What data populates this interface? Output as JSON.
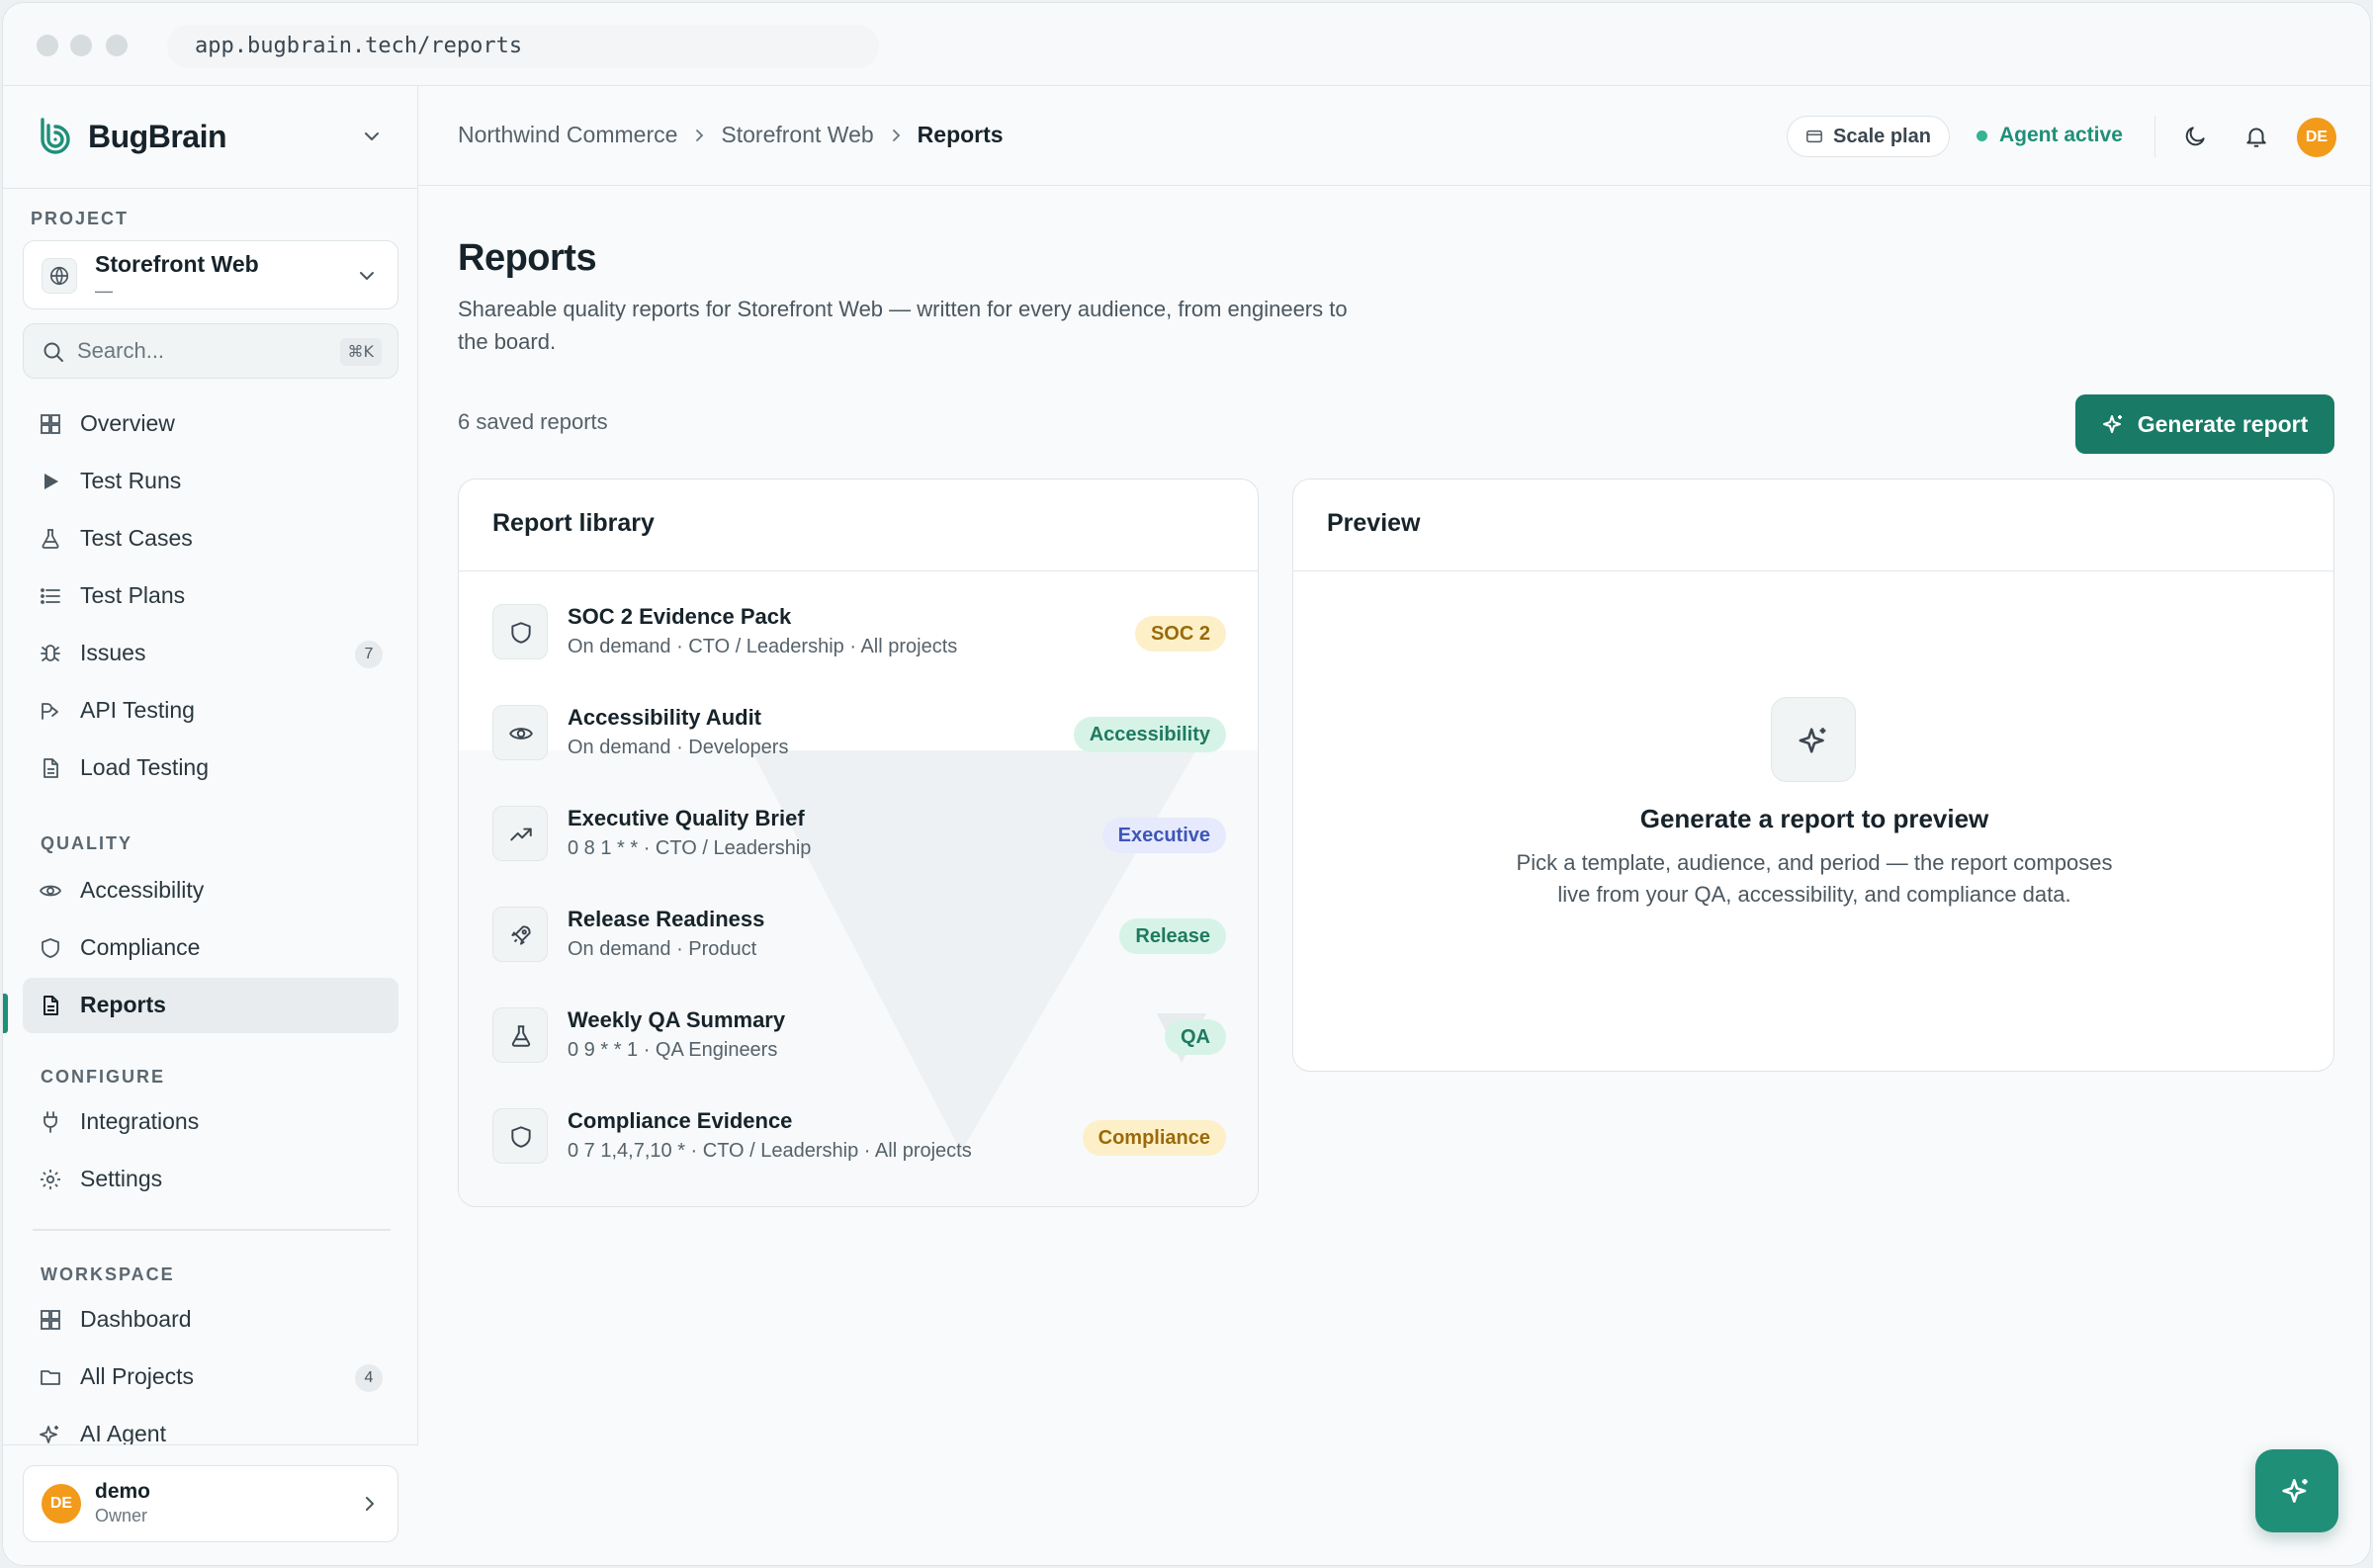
{
  "browser": {
    "url": "app.bugbrain.tech/reports"
  },
  "brand": {
    "name": "BugBrain"
  },
  "sidebar": {
    "project_label": "PROJECT",
    "project": {
      "name": "Storefront Web",
      "sub": "—"
    },
    "search": {
      "placeholder": "Search...",
      "shortcut": "⌘K"
    },
    "main_items": [
      {
        "label": "Overview",
        "icon": "grid-icon"
      },
      {
        "label": "Test Runs",
        "icon": "play-icon"
      },
      {
        "label": "Test Cases",
        "icon": "flask-icon"
      },
      {
        "label": "Test Plans",
        "icon": "list-icon"
      },
      {
        "label": "Issues",
        "icon": "bug-icon",
        "badge": "7"
      },
      {
        "label": "API Testing",
        "icon": "api-icon"
      },
      {
        "label": "Load Testing",
        "icon": "document-icon"
      }
    ],
    "quality_label": "QUALITY",
    "quality_items": [
      {
        "label": "Accessibility",
        "icon": "eye-icon"
      },
      {
        "label": "Compliance",
        "icon": "shield-icon"
      },
      {
        "label": "Reports",
        "icon": "report-icon",
        "active": true
      }
    ],
    "configure_label": "CONFIGURE",
    "configure_items": [
      {
        "label": "Integrations",
        "icon": "plug-icon"
      },
      {
        "label": "Settings",
        "icon": "gear-icon"
      }
    ],
    "workspace_label": "WORKSPACE",
    "workspace_items": [
      {
        "label": "Dashboard",
        "icon": "grid-icon"
      },
      {
        "label": "All Projects",
        "icon": "folder-icon",
        "badge": "4"
      },
      {
        "label": "AI Agent",
        "icon": "sparkle-icon"
      }
    ],
    "user": {
      "initials": "DE",
      "name": "demo",
      "role": "Owner"
    }
  },
  "header": {
    "breadcrumbs": [
      "Northwind Commerce",
      "Storefront Web",
      "Reports"
    ],
    "plan": "Scale plan",
    "agent_status": "Agent active",
    "avatar_initials": "DE"
  },
  "main": {
    "title": "Reports",
    "subtitle": "Shareable quality reports for Storefront Web — written for every audience, from engineers to the board.",
    "saved_count": "6 saved reports",
    "generate_label": "Generate report",
    "library": {
      "title": "Report library",
      "reports": [
        {
          "name": "SOC 2 Evidence Pack",
          "meta": "On demand · CTO / Leadership · All projects",
          "tag": "SOC 2",
          "tag_bg": "#fdf0c8",
          "tag_fg": "#9a6a0a",
          "icon": "shield-icon"
        },
        {
          "name": "Accessibility Audit",
          "meta": "On demand · Developers",
          "tag": "Accessibility",
          "tag_bg": "#d7f3e8",
          "tag_fg": "#1e7a5f",
          "icon": "eye-icon"
        },
        {
          "name": "Executive Quality Brief",
          "meta": "0 8 1 * * · CTO / Leadership",
          "tag": "Executive",
          "tag_bg": "#e6eafc",
          "tag_fg": "#3f55b8",
          "icon": "trend-icon"
        },
        {
          "name": "Release Readiness",
          "meta": "On demand · Product",
          "tag": "Release",
          "tag_bg": "#d7f3e8",
          "tag_fg": "#1e7a5f",
          "icon": "rocket-icon"
        },
        {
          "name": "Weekly QA Summary",
          "meta": "0 9 * * 1 · QA Engineers",
          "tag": "QA",
          "tag_bg": "#d7f3e8",
          "tag_fg": "#1e7a5f",
          "icon": "flask-icon"
        },
        {
          "name": "Compliance Evidence",
          "meta": "0 7 1,4,7,10 * · CTO / Leadership · All projects",
          "tag": "Compliance",
          "tag_bg": "#fdf0c8",
          "tag_fg": "#9a6a0a",
          "icon": "shield-icon"
        }
      ]
    },
    "preview": {
      "title": "Preview",
      "empty_title": "Generate a report to preview",
      "empty_desc": "Pick a template, audience, and period — the report composes live from your QA, accessibility, and compliance data."
    }
  },
  "colors": {
    "accent": "#197a66",
    "accent_light": "#1f8f78",
    "avatar": "#f29a1a"
  }
}
